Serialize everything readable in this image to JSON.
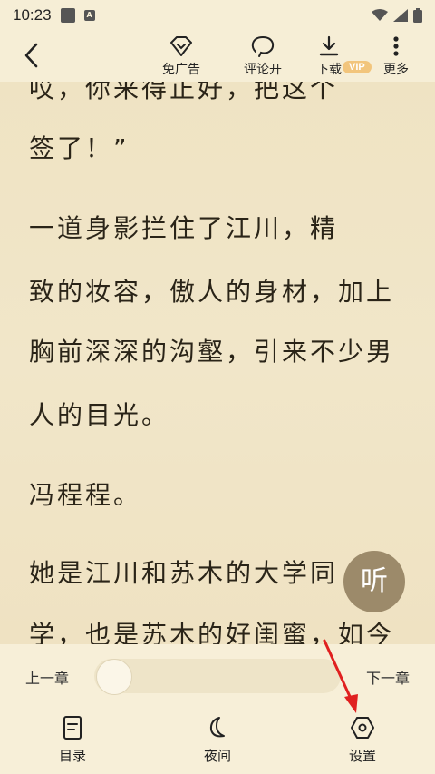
{
  "status_bar": {
    "time": "10:23"
  },
  "top_bar": {
    "actions": [
      {
        "label": "免广告",
        "icon": "diamond-icon"
      },
      {
        "label": "评论开",
        "icon": "comment-icon"
      },
      {
        "label": "下载",
        "icon": "download-icon"
      },
      {
        "label": "更多",
        "icon": "more-vertical-icon"
      }
    ],
    "vip_badge": "VIP"
  },
  "content": {
    "lines": [
      "    哎，你来得正好，把这个",
      "签了！”",
      "    一道身影拦住了江川，精",
      "致的妆容，傲人的身材，加上",
      "胸前深深的沟壑，引来不少男",
      "人的目光。",
      "    冯程程。",
      "    她是江川和苏木的大学同",
      "学，也是苏木的好闺蜜，如今"
    ]
  },
  "listen_button": "听",
  "chapter_nav": {
    "prev": "上一章",
    "next": "下一章",
    "progress": 0.0
  },
  "bottom_tabs": [
    {
      "label": "目录",
      "icon": "catalog-icon"
    },
    {
      "label": "夜间",
      "icon": "moon-icon"
    },
    {
      "label": "设置",
      "icon": "settings-hexagon-icon"
    }
  ],
  "colors": {
    "background": "#f3e9cf",
    "vip": "#f2c57c",
    "listen": "#9c8a6a",
    "arrow": "#e02020"
  }
}
